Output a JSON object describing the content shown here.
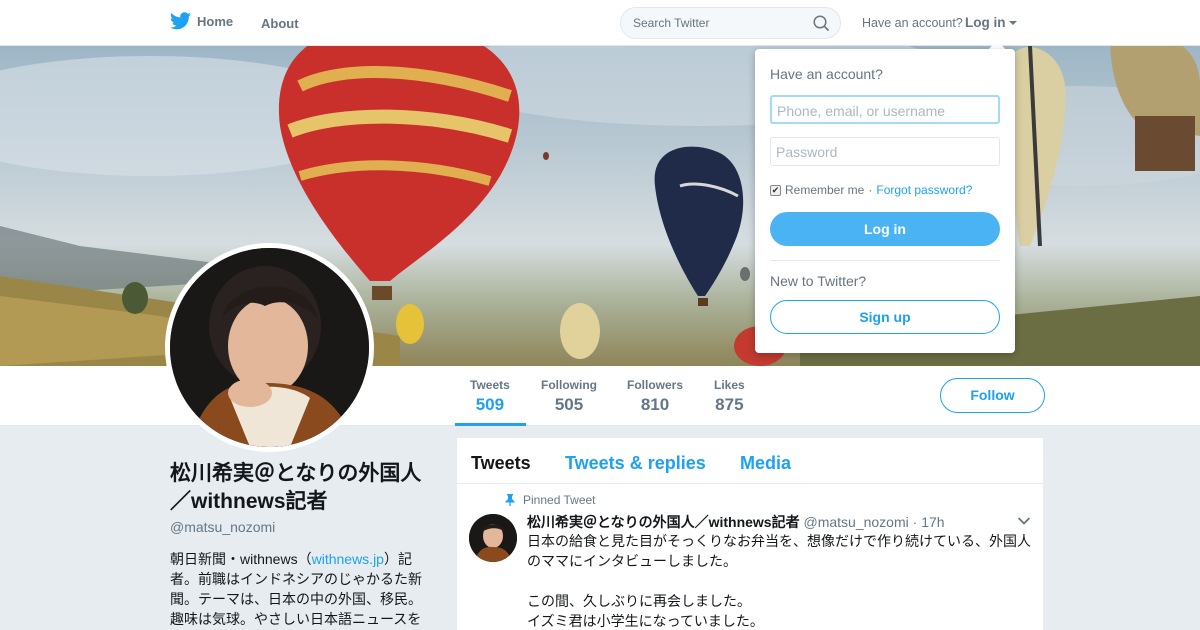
{
  "nav": {
    "home_label": "Home",
    "about_label": "About",
    "search_placeholder": "Search Twitter",
    "have_account": "Have an account?",
    "login_label": "Log in"
  },
  "stats": [
    {
      "label": "Tweets",
      "value": "509"
    },
    {
      "label": "Following",
      "value": "505"
    },
    {
      "label": "Followers",
      "value": "810"
    },
    {
      "label": "Likes",
      "value": "875"
    }
  ],
  "follow_label": "Follow",
  "profile": {
    "name": "松川希実＠となりの外国人／withnews記者",
    "handle": "@matsu_nozomi",
    "bio_part1": "朝日新聞・withnews（",
    "bio_link": "withnews.jp",
    "bio_part2": "）記者。前職はインドネシアのじゃかるた新聞。テーマは、日本の中の外国、移民。趣味は気球。やさしい日本語ニュースを"
  },
  "timeline": {
    "tabs": [
      "Tweets",
      "Tweets & replies",
      "Media"
    ],
    "pinned_label": "Pinned Tweet",
    "tweet": {
      "name": "松川希実＠となりの外国人／withnews記者",
      "handle": "@matsu_nozomi",
      "time": "· 17h",
      "line1": "日本の給食と見た目がそっくりなお弁当を、想像だけで作り続けている、外国人のママにインタビューしました。",
      "line2": "この間、久しぶりに再会しました。",
      "line3": "イズミ君は小学生になっていました。"
    }
  },
  "login_dropdown": {
    "title": "Have an account?",
    "username_placeholder": "Phone, email, or username",
    "password_placeholder": "Password",
    "remember_label": "Remember me",
    "separator": "·",
    "forgot_label": "Forgot password?",
    "login_button": "Log in",
    "new_label": "New to Twitter?",
    "signup_button": "Sign up"
  },
  "colors": {
    "accent": "#1da1f2",
    "login_button_bg": "#4ab3f4",
    "page_bg": "#e6ecf0"
  }
}
